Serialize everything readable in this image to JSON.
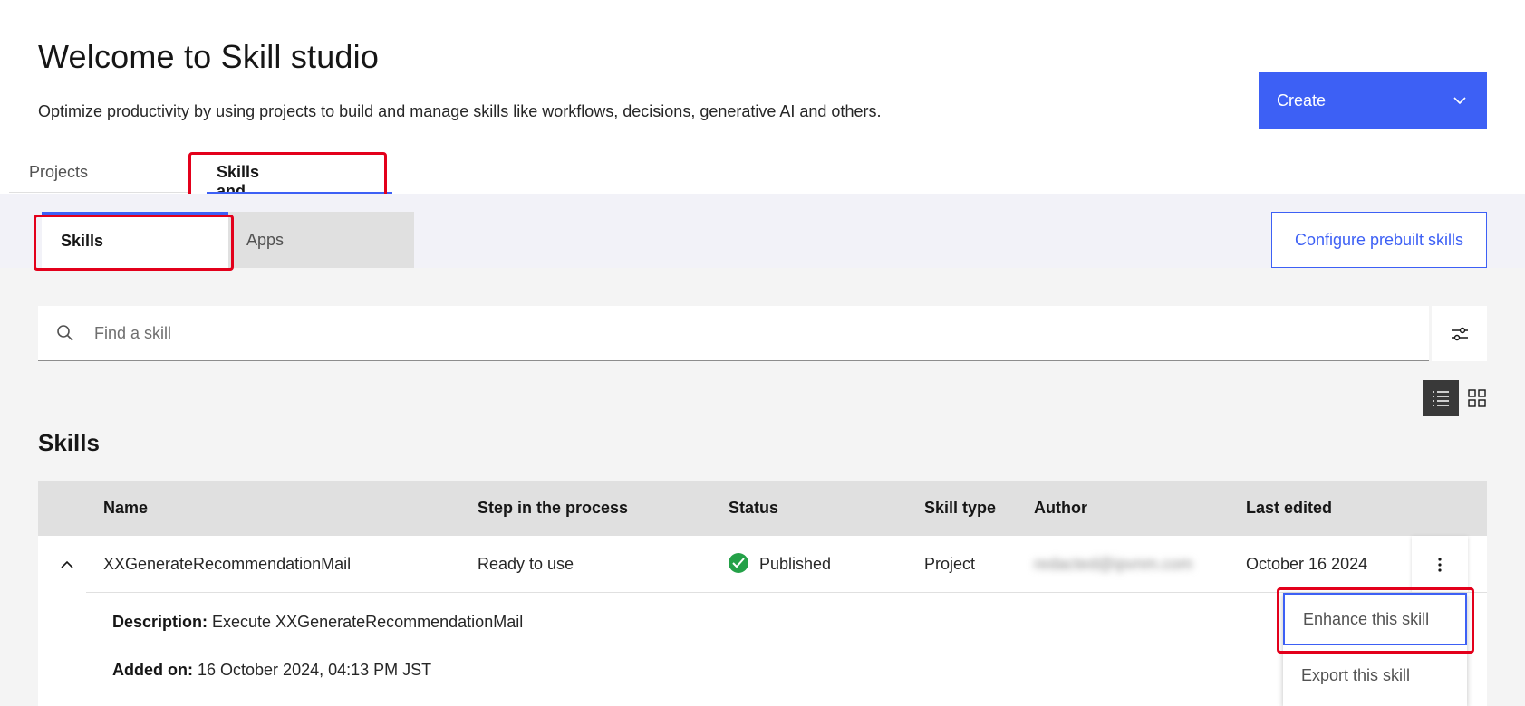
{
  "header": {
    "title": "Welcome to Skill studio",
    "subtitle": "Optimize productivity by using projects to build and manage skills like workflows, decisions, generative AI and others.",
    "create_label": "Create"
  },
  "tabs": [
    {
      "label": "Projects",
      "selected": false
    },
    {
      "label": "Skills and apps",
      "selected": true
    }
  ],
  "subtabs": [
    {
      "label": "Skills",
      "selected": true
    },
    {
      "label": "Apps",
      "selected": false
    }
  ],
  "configure_label": "Configure prebuilt skills",
  "search": {
    "placeholder": "Find a skill",
    "value": ""
  },
  "view": {
    "mode": "list"
  },
  "section_title": "Skills",
  "table": {
    "columns": [
      "Name",
      "Step in the process",
      "Status",
      "Skill type",
      "Author",
      "Last edited"
    ],
    "rows": [
      {
        "name": "XXGenerateRecommendationMail",
        "step": "Ready to use",
        "status": "Published",
        "type": "Project",
        "author": "redacted@ipvnm.com",
        "last_edited": "October 16 2024",
        "expanded": true,
        "description_label": "Description:",
        "description": "Execute XXGenerateRecommendationMail",
        "added_label": "Added on:",
        "added": "16 October 2024, 04:13 PM JST"
      }
    ]
  },
  "overflow_menu": {
    "items": [
      "Enhance this skill",
      "Export this skill"
    ]
  },
  "colors": {
    "accent": "#3d60f5",
    "highlight": "#e3001b",
    "status_published": "#24a148"
  }
}
